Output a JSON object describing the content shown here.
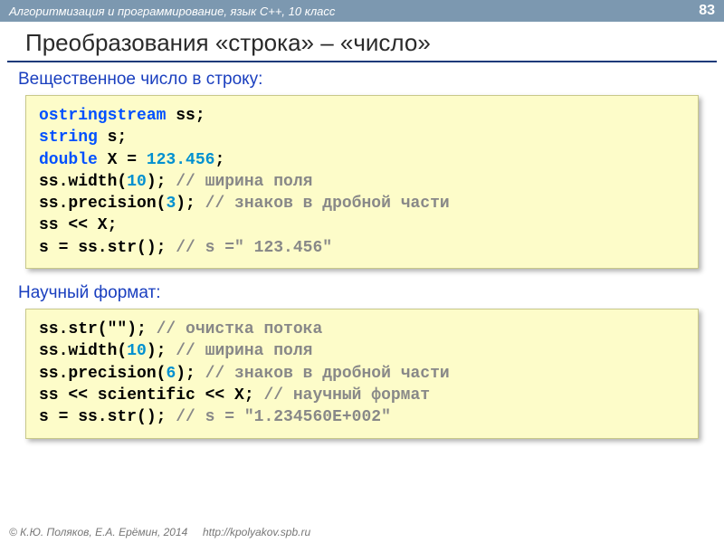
{
  "header": {
    "course": "Алгоритмизация и программирование, язык C++, 10 класс",
    "page": "83"
  },
  "title": "Преобразования «строка» – «число»",
  "section1": "Вещественное число в строку:",
  "code1": {
    "l1a": "ostringstream",
    "l1b": " ss;",
    "l2a": "string",
    "l2b": " s;",
    "l3a": "double",
    "l3b": " X = ",
    "l3c": "123.456",
    "l3d": ";",
    "l4a": "ss.width(",
    "l4b": "10",
    "l4c": ");     ",
    "l4d": "// ширина поля",
    "l5a": "ss.precision(",
    "l5b": "3",
    "l5c": "); ",
    "l5d": "// знаков в дробной части",
    "l6": "ss << X;",
    "l7a": "s = ss.str();     ",
    "l7b": "// s =\"   123.456\""
  },
  "section2": "Научный формат:",
  "code2": {
    "l1a": "ss.str(\"\");      ",
    "l1b": "// очистка потока",
    "l2a": "ss.width(",
    "l2b": "10",
    "l2c": ");    ",
    "l2d": "// ширина поля",
    "l3a": "ss.precision(",
    "l3b": "6",
    "l3c": "); ",
    "l3d": "// знаков в дробной части",
    "l4a": "ss << scientific << X; ",
    "l4b": "// научный формат",
    "l5a": "s = ss.str();    ",
    "l5b": "// s = \"1.234560E+002\""
  },
  "footer": {
    "copy": "© К.Ю. Поляков, Е.А. Ерёмин, 2014",
    "url": "http://kpolyakov.spb.ru"
  }
}
